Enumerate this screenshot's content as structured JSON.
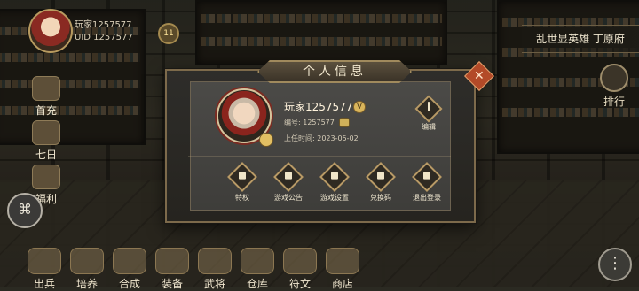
{
  "hud": {
    "player_name": "玩家1257577",
    "uid": "UID 1257577",
    "vip_level": "11",
    "server_banner": "乱世显英雄 丁原府",
    "ranking_label": "排行"
  },
  "side_menu": {
    "items": [
      {
        "label": "首充",
        "icon": "first-recharge-icon"
      },
      {
        "label": "七日",
        "icon": "seven-day-icon"
      },
      {
        "label": "福利",
        "icon": "welfare-icon"
      }
    ]
  },
  "bottom_nav": {
    "items": [
      {
        "label": "出兵",
        "icon": "battle-icon"
      },
      {
        "label": "培养",
        "icon": "train-icon"
      },
      {
        "label": "合成",
        "icon": "craft-icon"
      },
      {
        "label": "装备",
        "icon": "equipment-icon"
      },
      {
        "label": "武将",
        "icon": "general-icon"
      },
      {
        "label": "仓库",
        "icon": "warehouse-icon"
      },
      {
        "label": "符文",
        "icon": "rune-icon"
      },
      {
        "label": "商店",
        "icon": "shop-icon"
      }
    ]
  },
  "panel": {
    "title": "个人信息",
    "player_name": "玩家1257577",
    "player_id_label": "编号: 1257577",
    "appointment_date": "上任时间: 2023-05-02",
    "edit_label": "编辑",
    "actions": [
      {
        "label": "特权",
        "icon": "privilege-icon"
      },
      {
        "label": "游戏公告",
        "icon": "announcement-icon"
      },
      {
        "label": "游戏设置",
        "icon": "settings-gear-icon"
      },
      {
        "label": "兑换码",
        "icon": "redeem-code-icon"
      },
      {
        "label": "退出登录",
        "icon": "logout-icon"
      }
    ]
  }
}
